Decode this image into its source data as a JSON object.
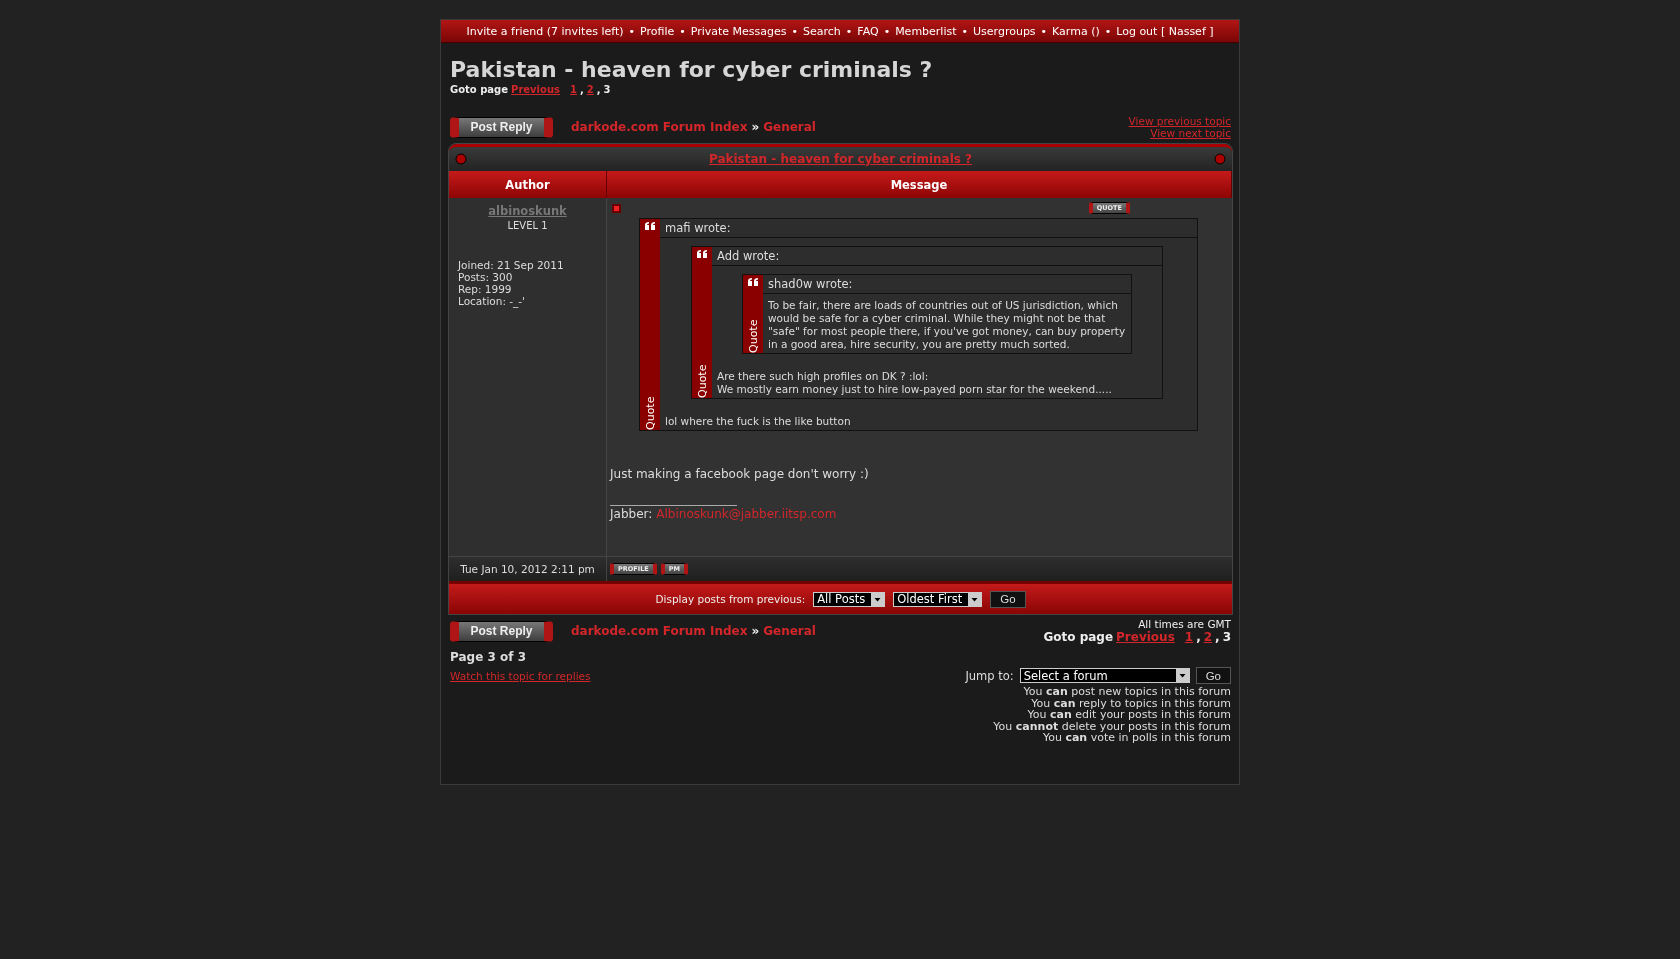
{
  "nav": {
    "separator": "•",
    "items": [
      "Invite a friend (7 invites left)",
      "Profile",
      "Private Messages",
      "Search",
      "FAQ",
      "Memberlist",
      "Usergroups",
      "Karma ()",
      "Log out [ Nassef ]"
    ]
  },
  "title": "Pakistan - heaven for cyber criminals ?",
  "top": {
    "goto": {
      "label": "Goto page",
      "previous": "Previous",
      "separator": ",",
      "pages": [
        {
          "label": "1",
          "selected": false
        },
        {
          "label": "2",
          "selected": false
        },
        {
          "label": "3",
          "selected": true
        }
      ]
    },
    "post_reply": "Post Reply",
    "breadcrumb": {
      "separator": "»",
      "items": [
        "darkode.com Forum Index",
        "General"
      ]
    },
    "topic_nav": [
      "View previous topic",
      "View next topic"
    ]
  },
  "table": {
    "title": "Pakistan - heaven for cyber criminals ?",
    "columns": [
      "Author",
      "Message"
    ],
    "post": {
      "author": "albinoskunk",
      "rank": "LEVEL 1",
      "details": [
        "Joined: 21 Sep 2011",
        "Posts: 300",
        "Rep: 1999",
        "Location: -_-'"
      ],
      "date": "Tue Jan 10, 2012 2:11 pm",
      "quote_button": "QUOTE",
      "profile_button": "PROFILE",
      "pm_button": "PM",
      "quote": {
        "header": "mafi wrote:",
        "side_label": "Quote",
        "lines": [
          "lol where the fuck is the like button"
        ],
        "quote": {
          "header": "Add wrote:",
          "side_label": "Quote",
          "lines": [
            "Are there such high profiles on DK ? :lol:",
            "We mostly earn money just to hire low-payed porn star for the weekend....."
          ],
          "quote": {
            "header": "shad0w wrote:",
            "side_label": "Quote",
            "lines": [
              "To be fair, there are loads of countries out of US jurisdiction, which would be safe for a cyber criminal. While they might not be that \"safe\" for most people there, if you've got money, can buy property in a good area, hire security, you are pretty much sorted."
            ]
          }
        }
      },
      "text": "Just making a facebook page don't worry :)",
      "signature": {
        "label": "Jabber:",
        "link": "Albinoskunk@jabber.iitsp.com"
      }
    },
    "display": {
      "label": "Display posts from previous:",
      "selects": [
        "All Posts",
        "Oldest First"
      ],
      "go": "Go"
    }
  },
  "bottom": {
    "post_reply": "Post Reply",
    "breadcrumb": {
      "separator": "»",
      "items": [
        "darkode.com Forum Index",
        "General"
      ]
    },
    "timezone": "All times are GMT",
    "goto": {
      "label": "Goto page",
      "previous": "Previous",
      "separator": ",",
      "pages": [
        {
          "label": "1",
          "selected": false
        },
        {
          "label": "2",
          "selected": false
        },
        {
          "label": "3",
          "selected": true
        }
      ]
    },
    "page_info": "Page 3 of 3",
    "watch": "Watch this topic for replies",
    "jump": {
      "label": "Jump to:",
      "select": "Select a forum",
      "go": "Go"
    },
    "permissions": [
      "You **can** post new topics in this forum",
      "You **can** reply to topics in this forum",
      "You **can** edit your posts in this forum",
      "You **cannot** delete your posts in this forum",
      "You **can** vote in polls in this forum"
    ]
  }
}
